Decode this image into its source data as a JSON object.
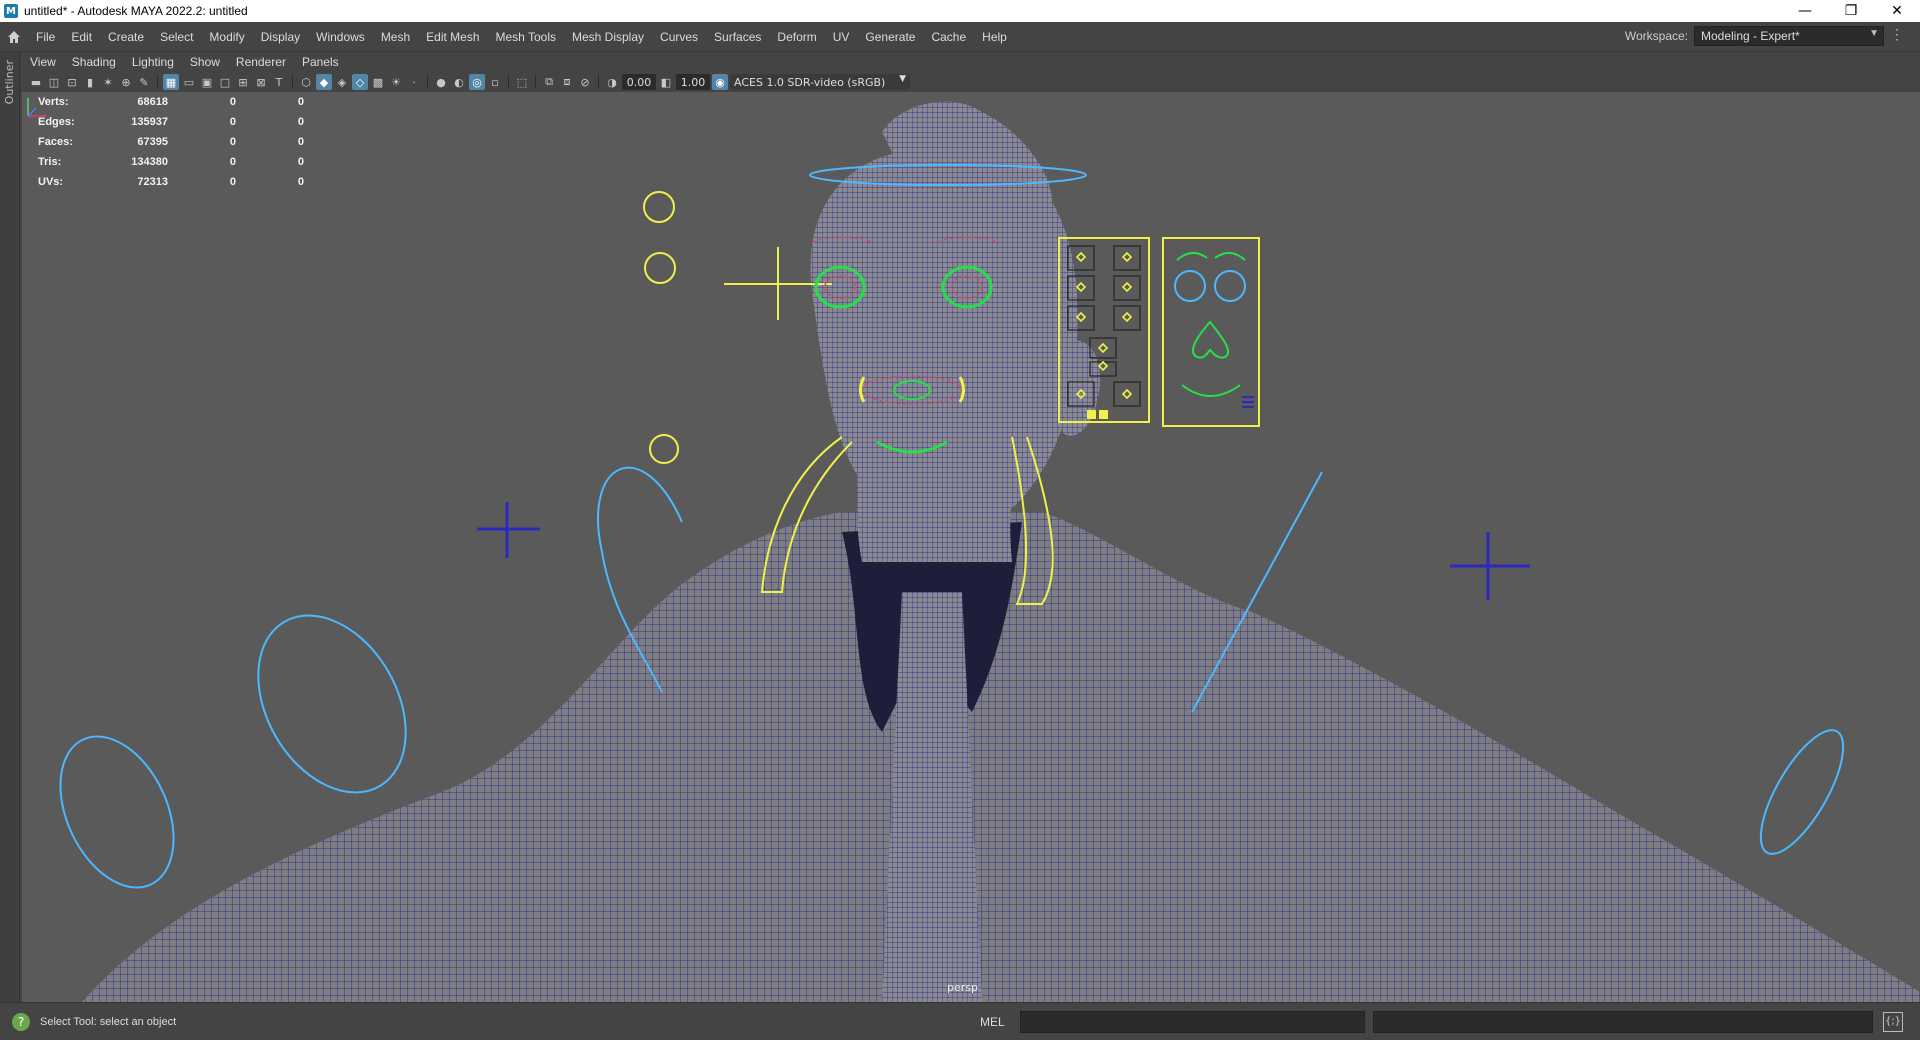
{
  "window": {
    "title": "untitled* - Autodesk MAYA 2022.2: untitled",
    "app_icon": "M",
    "controls": {
      "minimize": "—",
      "restore": "❐",
      "close": "✕"
    }
  },
  "menubar": {
    "items": [
      "File",
      "Edit",
      "Create",
      "Select",
      "Modify",
      "Display",
      "Windows",
      "Mesh",
      "Edit Mesh",
      "Mesh Tools",
      "Mesh Display",
      "Curves",
      "Surfaces",
      "Deform",
      "UV",
      "Generate",
      "Cache",
      "Help"
    ],
    "workspace_label": "Workspace:",
    "workspace_value": "Modeling - Expert*"
  },
  "outliner": {
    "label": "Outliner"
  },
  "panel_menu": {
    "items": [
      "View",
      "Shading",
      "Lighting",
      "Show",
      "Renderer",
      "Panels"
    ]
  },
  "panel_toolbar": {
    "exposure": "0.00",
    "gamma": "1.00",
    "colorspace": "ACES 1.0 SDR-video (sRGB)"
  },
  "hud": {
    "rows": [
      {
        "label": "Verts:",
        "v1": "68618",
        "v2": "0",
        "v3": "0"
      },
      {
        "label": "Edges:",
        "v1": "135937",
        "v2": "0",
        "v3": "0"
      },
      {
        "label": "Faces:",
        "v1": "67395",
        "v2": "0",
        "v3": "0"
      },
      {
        "label": "Tris:",
        "v1": "134380",
        "v2": "0",
        "v3": "0"
      },
      {
        "label": "UVs:",
        "v1": "72313",
        "v2": "0",
        "v3": "0"
      }
    ]
  },
  "viewport": {
    "camera": "persp",
    "colors": {
      "background": "#5a5a5a",
      "wire": "#1a1a8c",
      "ctrl_yellow": "#f0f04a",
      "ctrl_blue": "#4db8ff",
      "ctrl_green": "#26e04a"
    }
  },
  "statusbar": {
    "help_text": "Select Tool: select an object",
    "mel_label": "MEL"
  }
}
